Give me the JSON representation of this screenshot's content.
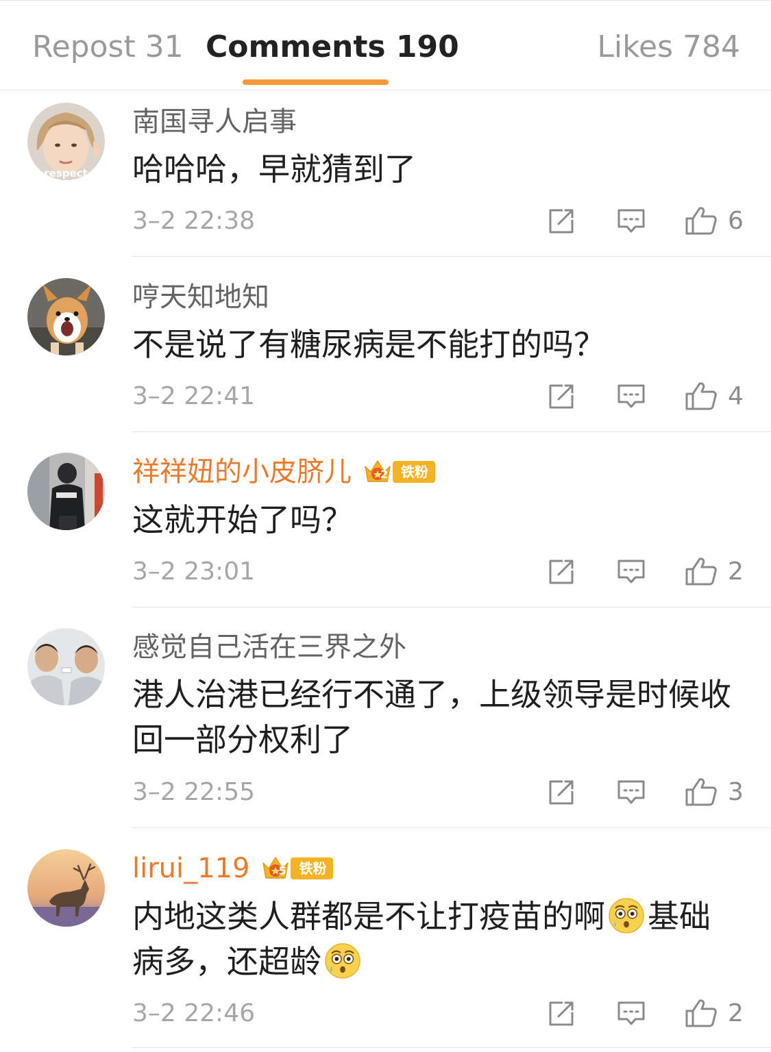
{
  "tabs": {
    "repost": "Repost 31",
    "comments": "Comments 190",
    "likes": "Likes 784"
  },
  "colors": {
    "accent": "#f29a3c",
    "vip_name": "#ea7a2c",
    "badge": "#f4b324"
  },
  "icons": {
    "repost": "share-arrow-icon",
    "reply": "comment-bubble-icon",
    "like": "thumbs-up-icon",
    "emoji": "flushed-tearful-face"
  },
  "comments": [
    {
      "username": "南国寻人启事",
      "text": "哈哈哈，早就猜到了",
      "time": "3–2 22:38",
      "likes": "6",
      "avatar_caption": "respect"
    },
    {
      "username": "哼天知地知",
      "text": "不是说了有糖尿病是不能打的吗？",
      "time": "3–2 22:41",
      "likes": "4"
    },
    {
      "username": "祥祥妞的小皮脐儿",
      "badge": {
        "level": "2",
        "label": "铁粉"
      },
      "text": "这就开始了吗？",
      "time": "3–2 23:01",
      "likes": "2"
    },
    {
      "username": "感觉自己活在三界之外",
      "text_line1": "港人治港已经行不通了，上级领导是时候收",
      "text_line2": "回一部分权利了",
      "time": "3–2 22:55",
      "likes": "3"
    },
    {
      "username": "lirui_119",
      "badge": {
        "level": "5",
        "label": "铁粉"
      },
      "text_part1": "内地这类人群都是不让打疫苗的啊",
      "text_part2": "基础",
      "text_part3": "病多，还超龄",
      "time": "3–2 22:46",
      "likes": "2"
    }
  ]
}
